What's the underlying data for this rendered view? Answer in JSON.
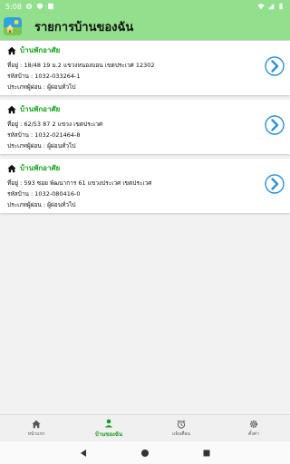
{
  "status": {
    "time": "5:08"
  },
  "app": {
    "title": "รายการบ้านของฉัน"
  },
  "cards": [
    {
      "type": "บ้านพักอาศัย",
      "address": "ที่อยู่ : 18/48 19 ม.2   แขวงหนองบอน เขตประเวศ 12302",
      "house_code": "รหัสบ้าน : 1032-033264-1",
      "tax_type": "ประเภทผู้ผ่อน : ผู้ผ่อนทั่วไป"
    },
    {
      "type": "บ้านพักอาศัย",
      "address": "ที่อยู่ : 62/53 87 2   แขวง เขตประเวศ",
      "house_code": "รหัสบ้าน : 1032-021464-8",
      "tax_type": "ประเภทผู้ผ่อน : ผู้ผ่อนทั่วไป"
    },
    {
      "type": "บ้านพักอาศัย",
      "address": "ที่อยู่ :  593  ซอย พัฒนาการ 61  แขวงประเวศ เขตประเวศ",
      "house_code": "รหัสบ้าน : 1032-080416-0",
      "tax_type": "ประเภทผู้ผ่อน : ผู้ผ่อนทั่วไป"
    }
  ],
  "bottom_nav": [
    {
      "label": "หน้าแรก",
      "icon": "home-icon",
      "active": false
    },
    {
      "label": "บ้านของฉัน",
      "icon": "person-icon",
      "active": true
    },
    {
      "label": "แจ้งเตือน",
      "icon": "alarm-icon",
      "active": false
    },
    {
      "label": "ตั้งค่า",
      "icon": "gear-icon",
      "active": false
    }
  ],
  "colors": {
    "header": "#92e08d",
    "accent": "#17a51c",
    "arrow": "#2c8fd6"
  }
}
